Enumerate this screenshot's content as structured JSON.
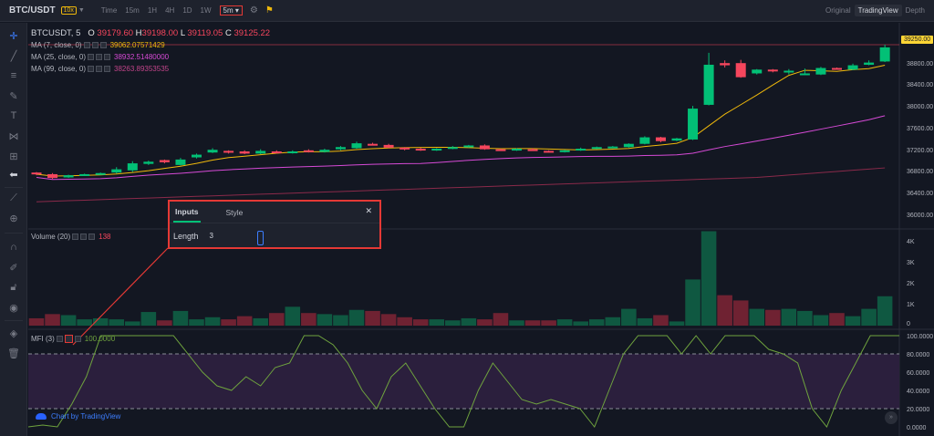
{
  "topbar": {
    "symbol": "BTC/USDT",
    "leverage": "10x",
    "timeframes": [
      "Time",
      "15m",
      "1H",
      "4H",
      "1D",
      "1W"
    ],
    "selected_interval": "5m",
    "views": [
      "Original",
      "TradingView",
      "Depth"
    ],
    "active_view": "TradingView"
  },
  "legend": {
    "title": "BTCUSDT, 5",
    "open_label": "O",
    "open": "39179.60",
    "high_label": "H",
    "high": "39198.00",
    "low_label": "L",
    "low": "39119.05",
    "close_label": "C",
    "close": "39125.22",
    "ma7_label": "MA (7, close, 0)",
    "ma7_value": "39062.07571429",
    "ma25_label": "MA (25, close, 0)",
    "ma25_value": "38932.51480000",
    "ma99_label": "MA (99, close, 0)",
    "ma99_value": "38263.89353535",
    "volume_label": "Volume (20)",
    "volume_value": "138",
    "mfi_label": "MFI (3)",
    "mfi_value": "100.0000"
  },
  "colors": {
    "up": "#02c076",
    "down": "#f6465d",
    "ma7": "#f0b90b",
    "ma25": "#d64ad6",
    "ma99": "#8a2a4a",
    "price_tag": "#fcd535",
    "mfi_line": "#6fa33e",
    "mfi_band": "#2b1f3d"
  },
  "price_axis": [
    "38800.00",
    "38400.00",
    "38000.00",
    "37600.00",
    "37200.00",
    "36800.00",
    "36400.00",
    "36000.00"
  ],
  "last_price": "39250.00",
  "volume_axis": [
    "4K",
    "3K",
    "2K",
    "1K",
    "0"
  ],
  "mfi_axis": [
    "100.0000",
    "80.0000",
    "60.0000",
    "40.0000",
    "20.0000",
    "0.0000"
  ],
  "dialog": {
    "tab_inputs": "Inputs",
    "tab_style": "Style",
    "close_icon": "close-icon",
    "length_label": "Length",
    "length_value": "3"
  },
  "branding": "Chart by TradingView",
  "chart_data": {
    "type": "candlestick",
    "candles": [
      {
        "o": 36890,
        "c": 36860,
        "h": 36900,
        "l": 36840
      },
      {
        "o": 36860,
        "c": 36790,
        "h": 36880,
        "l": 36770
      },
      {
        "o": 36800,
        "c": 36840,
        "h": 36850,
        "l": 36790
      },
      {
        "o": 36850,
        "c": 36860,
        "h": 36870,
        "l": 36830
      },
      {
        "o": 36860,
        "c": 36880,
        "h": 36890,
        "l": 36850
      },
      {
        "o": 36890,
        "c": 36950,
        "h": 36990,
        "l": 36870
      },
      {
        "o": 36930,
        "c": 37060,
        "h": 37100,
        "l": 36900
      },
      {
        "o": 37050,
        "c": 37090,
        "h": 37110,
        "l": 37030
      },
      {
        "o": 37120,
        "c": 37080,
        "h": 37130,
        "l": 37060
      },
      {
        "o": 37030,
        "c": 37130,
        "h": 37160,
        "l": 37020
      },
      {
        "o": 37170,
        "c": 37220,
        "h": 37240,
        "l": 37150
      },
      {
        "o": 37260,
        "c": 37310,
        "h": 37340,
        "l": 37250
      },
      {
        "o": 37290,
        "c": 37270,
        "h": 37300,
        "l": 37240
      },
      {
        "o": 37280,
        "c": 37240,
        "h": 37300,
        "l": 37230
      },
      {
        "o": 37240,
        "c": 37290,
        "h": 37320,
        "l": 37230
      },
      {
        "o": 37280,
        "c": 37260,
        "h": 37300,
        "l": 37240
      },
      {
        "o": 37250,
        "c": 37280,
        "h": 37300,
        "l": 37240
      },
      {
        "o": 37300,
        "c": 37270,
        "h": 37320,
        "l": 37260
      },
      {
        "o": 37270,
        "c": 37310,
        "h": 37330,
        "l": 37260
      },
      {
        "o": 37320,
        "c": 37360,
        "h": 37380,
        "l": 37300
      },
      {
        "o": 37340,
        "c": 37430,
        "h": 37460,
        "l": 37330
      },
      {
        "o": 37420,
        "c": 37400,
        "h": 37440,
        "l": 37390
      },
      {
        "o": 37400,
        "c": 37350,
        "h": 37420,
        "l": 37340
      },
      {
        "o": 37350,
        "c": 37320,
        "h": 37360,
        "l": 37300
      },
      {
        "o": 37330,
        "c": 37300,
        "h": 37350,
        "l": 37290
      },
      {
        "o": 37300,
        "c": 37330,
        "h": 37340,
        "l": 37290
      },
      {
        "o": 37330,
        "c": 37360,
        "h": 37380,
        "l": 37320
      },
      {
        "o": 37360,
        "c": 37390,
        "h": 37400,
        "l": 37350
      },
      {
        "o": 37390,
        "c": 37320,
        "h": 37410,
        "l": 37310
      },
      {
        "o": 37320,
        "c": 37300,
        "h": 37330,
        "l": 37290
      },
      {
        "o": 37300,
        "c": 37330,
        "h": 37340,
        "l": 37290
      },
      {
        "o": 37320,
        "c": 37300,
        "h": 37340,
        "l": 37290
      },
      {
        "o": 37290,
        "c": 37270,
        "h": 37300,
        "l": 37260
      },
      {
        "o": 37270,
        "c": 37300,
        "h": 37310,
        "l": 37260
      },
      {
        "o": 37300,
        "c": 37330,
        "h": 37350,
        "l": 37290
      },
      {
        "o": 37330,
        "c": 37360,
        "h": 37370,
        "l": 37320
      },
      {
        "o": 37360,
        "c": 37370,
        "h": 37380,
        "l": 37350
      },
      {
        "o": 37360,
        "c": 37420,
        "h": 37430,
        "l": 37350
      },
      {
        "o": 37420,
        "c": 37540,
        "h": 37560,
        "l": 37410
      },
      {
        "o": 37540,
        "c": 37470,
        "h": 37550,
        "l": 37450
      },
      {
        "o": 37480,
        "c": 37520,
        "h": 37530,
        "l": 37470
      },
      {
        "o": 37500,
        "c": 38070,
        "h": 38120,
        "l": 37490
      },
      {
        "o": 38140,
        "c": 38880,
        "h": 39100,
        "l": 38130
      },
      {
        "o": 38910,
        "c": 38870,
        "h": 38960,
        "l": 38830
      },
      {
        "o": 38910,
        "c": 38650,
        "h": 38970,
        "l": 38640
      },
      {
        "o": 38720,
        "c": 38790,
        "h": 38800,
        "l": 38700
      },
      {
        "o": 38790,
        "c": 38760,
        "h": 38800,
        "l": 38740
      },
      {
        "o": 38760,
        "c": 38770,
        "h": 38800,
        "l": 38700
      },
      {
        "o": 38700,
        "c": 38720,
        "h": 38810,
        "l": 38690
      },
      {
        "o": 38700,
        "c": 38820,
        "h": 38840,
        "l": 38690
      },
      {
        "o": 38820,
        "c": 38800,
        "h": 38830,
        "l": 38790
      },
      {
        "o": 38790,
        "c": 38870,
        "h": 38900,
        "l": 38780
      },
      {
        "o": 38880,
        "c": 38920,
        "h": 38960,
        "l": 38870
      },
      {
        "o": 38940,
        "c": 39200,
        "h": 39250,
        "l": 38930
      }
    ],
    "volume": [
      0.35,
      0.55,
      0.5,
      0.3,
      0.35,
      0.3,
      0.2,
      0.65,
      0.25,
      0.7,
      0.3,
      0.4,
      0.3,
      0.45,
      0.35,
      0.6,
      0.9,
      0.6,
      0.55,
      0.5,
      0.75,
      0.7,
      0.55,
      0.4,
      0.3,
      0.3,
      0.25,
      0.35,
      0.3,
      0.6,
      0.25,
      0.25,
      0.25,
      0.3,
      0.2,
      0.3,
      0.4,
      0.8,
      0.35,
      0.5,
      0.2,
      2.2,
      4.5,
      1.45,
      1.2,
      0.8,
      0.75,
      0.8,
      0.7,
      0.5,
      0.6,
      0.45,
      0.8,
      1.4
    ],
    "mfi": [
      0,
      2,
      0,
      25,
      55,
      100,
      100,
      100,
      100,
      100,
      100,
      80,
      60,
      45,
      40,
      55,
      45,
      65,
      70,
      100,
      100,
      90,
      70,
      40,
      20,
      55,
      70,
      45,
      20,
      0,
      0,
      40,
      70,
      50,
      30,
      25,
      30,
      25,
      20,
      0,
      40,
      80,
      100,
      100,
      100,
      80,
      100,
      80,
      100,
      100,
      100,
      85,
      80,
      70,
      20,
      0,
      40,
      70,
      100,
      100,
      100
    ]
  }
}
